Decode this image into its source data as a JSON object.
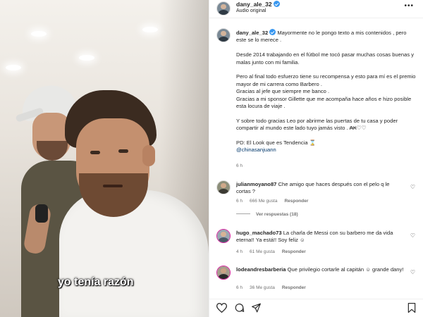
{
  "media": {
    "caption": "yo tenía razón"
  },
  "header": {
    "username": "dany_ale_32",
    "subtitle": "Audio original",
    "more_icon": "•••"
  },
  "post": {
    "username": "dany_ale_32",
    "paragraphs": [
      "Mayormente no le pongo texto a mis contenidos , pero este se lo merece .",
      "Desde 2014 trabajando en el fútbol me tocó pasar muchas cosas buenas y malas junto con mi familia.",
      "Pero al final todo esfuerzo tiene su recompensa y esto para mí es el premio mayor de mi carrera como Barbero .\nGracias al jefe que siempre me banco .\nGracias a mi sponsor Gillette que me acompaña hace años e hizo posible esta locura de viaje .",
      "Y sobre todo gracias Leo por abrirme las puertas de tu casa y poder compartir al mundo este lado tuyo jamás visto . ₳₭♡♡",
      "PD: El Look que es Tendencia ⌛"
    ],
    "mention": "@chinasanjuann",
    "time": "6 h"
  },
  "comments": [
    {
      "username": "julianmoyano87",
      "text": "Che amigo que haces después con el pelo q le cortas ?",
      "time": "6 h",
      "likes": "666 Me gusta",
      "reply": "Responder",
      "view_replies": "Ver respuestas (18)"
    },
    {
      "username": "hugo_machado73",
      "text": "La charla de Messi con su barbero me da vida eterna!! Ya está!! Soy feliz ☺",
      "time": "4 h",
      "likes": "61 Me gusta",
      "reply": "Responder"
    },
    {
      "username": "lodeandresbarberia",
      "text": "Que privilegio cortarle al capitán ☺ grande dany!",
      "time": "6 h",
      "likes": "36 Me gusta",
      "reply": "Responder"
    }
  ],
  "icons": {
    "heart": "heart-icon",
    "comment": "comment-icon",
    "share": "share-icon",
    "save": "bookmark-icon"
  },
  "colors": {
    "verified": "#3897f0",
    "meta_text": "#737373",
    "mention": "#00376b"
  }
}
